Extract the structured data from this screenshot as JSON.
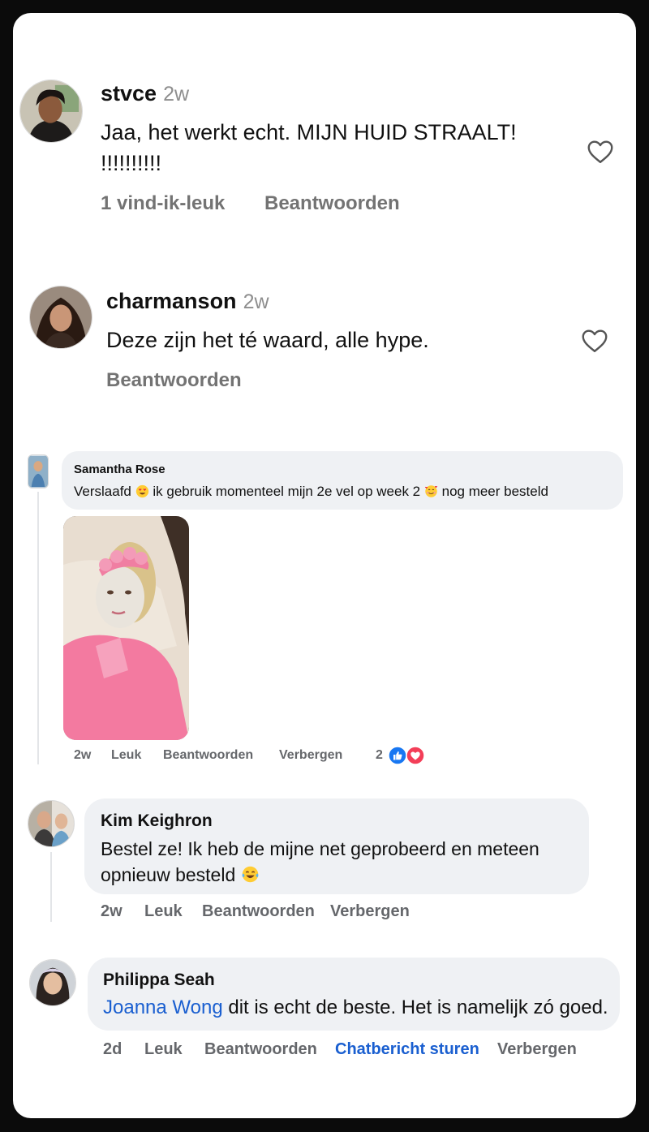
{
  "comments": {
    "c1": {
      "username": "stvce",
      "time": "2w",
      "text": "Jaa, het werkt echt. MIJN HUID STRAALT!",
      "text2": "!!!!!!!!!!",
      "likes": "1 vind-ik-leuk",
      "reply": "Beantwoorden",
      "heart_icon": "heart-outline-icon"
    },
    "c2": {
      "username": "charmanson",
      "time": "2w",
      "text": "Deze zijn het té waard, alle hype.",
      "reply": "Beantwoorden",
      "heart_icon": "heart-outline-icon"
    },
    "c3": {
      "name": "Samantha Rose",
      "text_a": "Verslaafd",
      "text_b": "ik gebruik momenteel mijn 2e vel op week 2",
      "text_c": "nog meer besteld",
      "time": "2w",
      "like": "Leuk",
      "reply": "Beantwoorden",
      "hide": "Verbergen",
      "reaction_count": "2",
      "reaction_icons": [
        "like-reaction-icon",
        "love-reaction-icon"
      ]
    },
    "c4": {
      "name": "Kim Keighron",
      "text_a": "Bestel ze! Ik heb de mijne net geprobeerd en meteen",
      "text_b": "opnieuw besteld",
      "time": "2w",
      "like": "Leuk",
      "reply": "Beantwoorden",
      "hide": "Verbergen"
    },
    "c5": {
      "name": "Philippa Seah",
      "mention": "Joanna Wong",
      "text": " dit is echt de beste. Het is namelijk zó goed.",
      "time": "2d",
      "like": "Leuk",
      "reply": "Beantwoorden",
      "message": "Chatbericht sturen",
      "hide": "Verbergen"
    }
  },
  "colors": {
    "link_blue": "#1a5fd0",
    "bubble_bg": "#eff1f4",
    "meta_gray": "#65676b"
  }
}
